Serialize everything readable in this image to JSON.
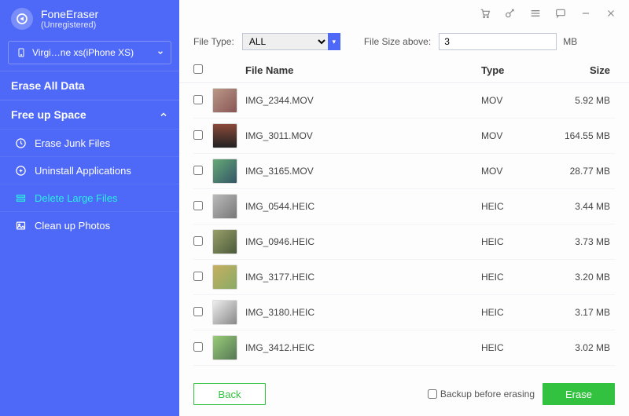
{
  "brand": {
    "name": "FoneEraser",
    "sub": "(Unregistered)"
  },
  "device": {
    "label": "Virgi…ne xs(iPhone XS)"
  },
  "nav": {
    "eraseAll": "Erase All Data",
    "freeUp": "Free up Space",
    "items": [
      {
        "label": "Erase Junk Files"
      },
      {
        "label": "Uninstall Applications"
      },
      {
        "label": "Delete Large Files"
      },
      {
        "label": "Clean up Photos"
      }
    ]
  },
  "filters": {
    "fileTypeLabel": "File Type:",
    "fileTypeValue": "ALL",
    "fileSizeLabel": "File Size above:",
    "fileSizeValue": "3",
    "fileSizeUnit": "MB"
  },
  "columns": {
    "name": "File Name",
    "type": "Type",
    "size": "Size"
  },
  "files": [
    {
      "name": "IMG_2344.MOV",
      "type": "MOV",
      "size": "5.92 MB"
    },
    {
      "name": "IMG_3011.MOV",
      "type": "MOV",
      "size": "164.55 MB"
    },
    {
      "name": "IMG_3165.MOV",
      "type": "MOV",
      "size": "28.77 MB"
    },
    {
      "name": "IMG_0544.HEIC",
      "type": "HEIC",
      "size": "3.44 MB"
    },
    {
      "name": "IMG_0946.HEIC",
      "type": "HEIC",
      "size": "3.73 MB"
    },
    {
      "name": "IMG_3177.HEIC",
      "type": "HEIC",
      "size": "3.20 MB"
    },
    {
      "name": "IMG_3180.HEIC",
      "type": "HEIC",
      "size": "3.17 MB"
    },
    {
      "name": "IMG_3412.HEIC",
      "type": "HEIC",
      "size": "3.02 MB"
    }
  ],
  "footer": {
    "back": "Back",
    "backup": "Backup before erasing",
    "erase": "Erase"
  }
}
